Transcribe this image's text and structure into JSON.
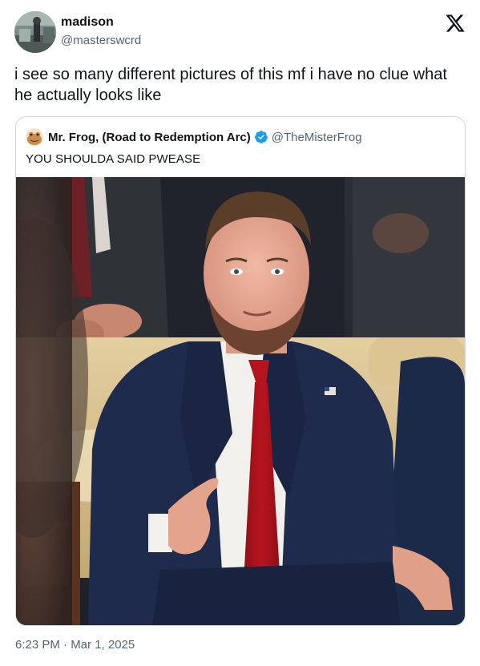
{
  "author": {
    "display_name": "madison",
    "handle": "@masterswcrd"
  },
  "tweet": {
    "text": "i see so many different pictures of this mf i have no clue what he actually looks like",
    "timestamp": "6:23 PM · Mar 1, 2025"
  },
  "quote": {
    "display_name": "Mr. Frog, (Road to Redemption Arc)",
    "handle": "@TheMisterFrog",
    "text": "YOU SHOULDA SAID PWEASE",
    "verified": true
  },
  "colors": {
    "text_primary": "#0f1419",
    "text_secondary": "#536471",
    "border": "#cfd9de",
    "verified_blue": "#1d9bf0"
  },
  "icons": {
    "brand": "x-logo-icon",
    "verified": "verified-badge-icon"
  }
}
